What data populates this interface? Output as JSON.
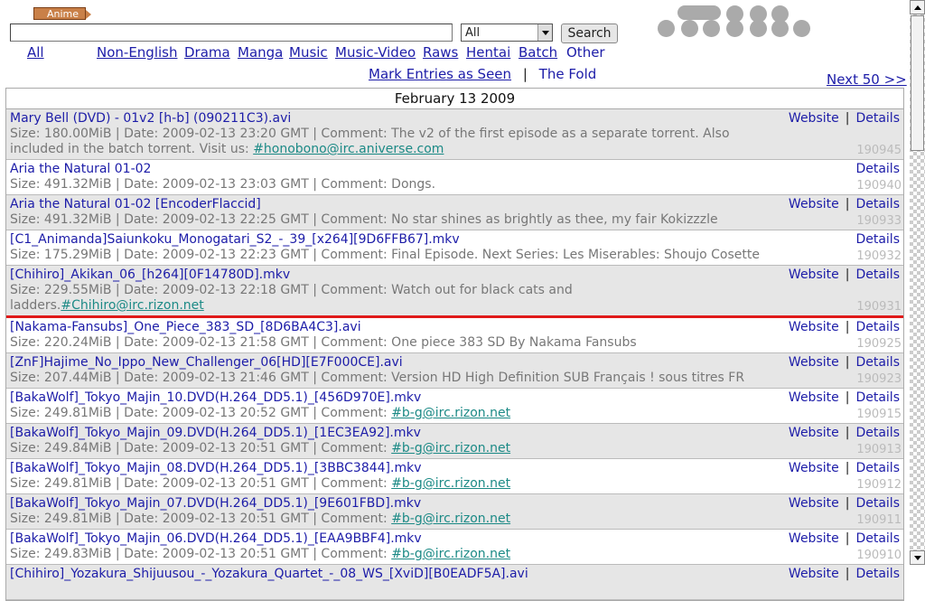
{
  "header": {
    "category_badge": "Anime",
    "search_value": "",
    "filter_selected": "All",
    "search_button": "Search"
  },
  "categories": [
    "All",
    "Non-English",
    "Drama",
    "Manga",
    "Music",
    "Music-Video",
    "Raws",
    "Hentai",
    "Batch",
    "Other"
  ],
  "actions": {
    "mark_seen": "Mark Entries as Seen",
    "separator": "|",
    "the_fold": "The Fold",
    "next": "Next 50 >>"
  },
  "day": "February 13 2009",
  "labels": {
    "website": "Website",
    "details": "Details",
    "pipe": "|"
  },
  "entries": [
    {
      "title": "Mary Bell (DVD) - 01v2 [h-b] (090211C3).avi",
      "meta": "Size: 180.00MiB | Date: 2009-02-13 23:20 GMT | Comment: The v2 of the first episode as a separate torrent. Also included in the batch torrent. Visit us: ",
      "link": "#honobono@irc.aniverse.com",
      "id": "190945",
      "website": true,
      "alt": true
    },
    {
      "title": "Aria the Natural 01-02",
      "meta": "Size: 491.32MiB | Date: 2009-02-13 23:03 GMT | Comment: Dongs.",
      "link": "",
      "id": "190940",
      "website": false,
      "alt": false
    },
    {
      "title": "Aria the Natural 01-02 [EncoderFlaccid]",
      "meta": "Size: 491.32MiB | Date: 2009-02-13 22:25 GMT | Comment: No star shines as brightly as thee, my fair Kokizzzle",
      "link": "",
      "id": "190933",
      "website": true,
      "alt": true
    },
    {
      "title": "[C1_Animanda]Saiunkoku_Monogatari_S2_-_39_[x264][9D6FFB67].mkv",
      "meta": "Size: 175.29MiB | Date: 2009-02-13 22:23 GMT | Comment: Final Episode. Next Series: Les Miserables: Shoujo Cosette",
      "link": "",
      "id": "190932",
      "website": false,
      "alt": false
    },
    {
      "title": "[Chihiro]_Akikan_06_[h264][0F14780D].mkv",
      "meta": "Size: 229.55MiB | Date: 2009-02-13 22:18 GMT | Comment: Watch out for black cats and ladders.",
      "link": "#Chihiro@irc.rizon.net",
      "id": "190931",
      "website": true,
      "alt": true,
      "fold": true
    },
    {
      "title": "[Nakama-Fansubs]_One_Piece_383_SD_[8D6BA4C3].avi",
      "meta": "Size: 220.24MiB | Date: 2009-02-13 21:58 GMT | Comment: One piece 383 SD By Nakama Fansubs",
      "link": "",
      "id": "190925",
      "website": true,
      "alt": false
    },
    {
      "title": "[ZnF]Hajime_No_Ippo_New_Challenger_06[HD][E7F000CE].avi",
      "meta": "Size: 207.44MiB | Date: 2009-02-13 21:46 GMT | Comment: Version HD High Definition SUB Français ! sous titres FR",
      "link": "",
      "id": "190923",
      "website": true,
      "alt": true
    },
    {
      "title": "[BakaWolf]_Tokyo_Majin_10.DVD(H.264_DD5.1)_[456D970E].mkv",
      "meta": "Size: 249.81MiB | Date: 2009-02-13 20:52 GMT | Comment: ",
      "link": "#b-g@irc.rizon.net",
      "id": "190915",
      "website": true,
      "alt": false
    },
    {
      "title": "[BakaWolf]_Tokyo_Majin_09.DVD(H.264_DD5.1)_[1EC3EA92].mkv",
      "meta": "Size: 249.84MiB | Date: 2009-02-13 20:51 GMT | Comment: ",
      "link": "#b-g@irc.rizon.net",
      "id": "190913",
      "website": true,
      "alt": true
    },
    {
      "title": "[BakaWolf]_Tokyo_Majin_08.DVD(H.264_DD5.1)_[3BBC3844].mkv",
      "meta": "Size: 249.81MiB | Date: 2009-02-13 20:51 GMT | Comment: ",
      "link": "#b-g@irc.rizon.net",
      "id": "190912",
      "website": true,
      "alt": false
    },
    {
      "title": "[BakaWolf]_Tokyo_Majin_07.DVD(H.264_DD5.1)_[9E601FBD].mkv",
      "meta": "Size: 249.81MiB | Date: 2009-02-13 20:51 GMT | Comment: ",
      "link": "#b-g@irc.rizon.net",
      "id": "190911",
      "website": true,
      "alt": true
    },
    {
      "title": "[BakaWolf]_Tokyo_Majin_06.DVD(H.264_DD5.1)_[EAA9BBF4].mkv",
      "meta": "Size: 249.83MiB | Date: 2009-02-13 20:51 GMT | Comment: ",
      "link": "#b-g@irc.rizon.net",
      "id": "190910",
      "website": true,
      "alt": false
    },
    {
      "title": "[Chihiro]_Yozakura_Shijuusou_-_Yozakura_Quartet_-_08_WS_[XviD][B0EADF5A].avi",
      "meta": "",
      "link": "",
      "id": "",
      "website": true,
      "alt": true
    }
  ]
}
